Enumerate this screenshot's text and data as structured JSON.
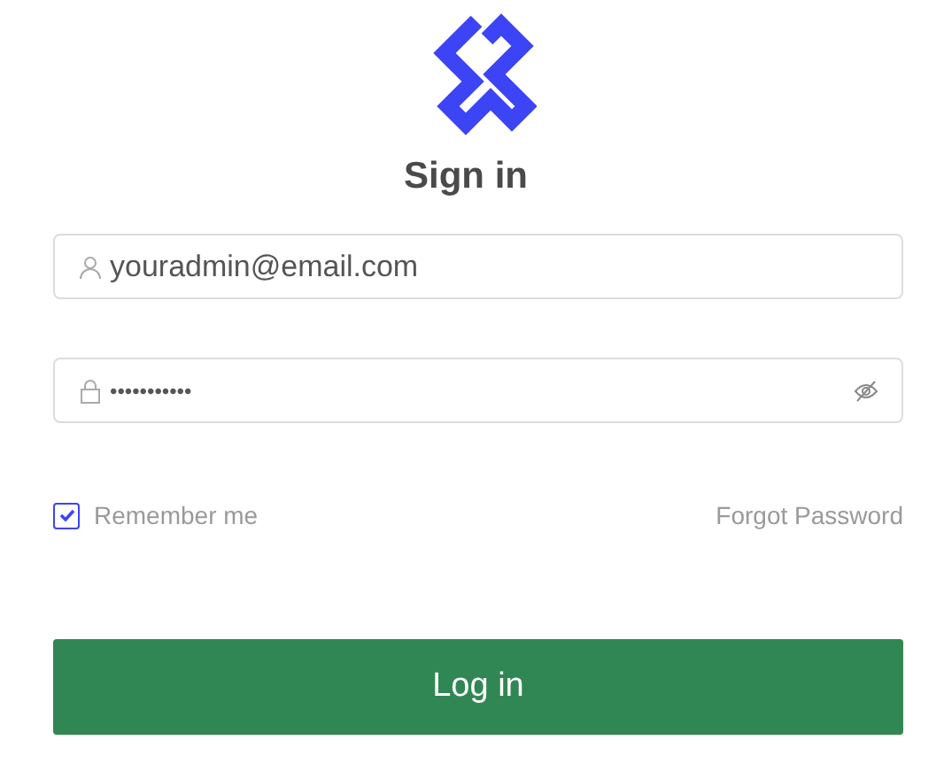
{
  "title": "Sign in",
  "email": {
    "value": "youradmin@email.com"
  },
  "password": {
    "value": "•••••••••••"
  },
  "remember": {
    "label": "Remember me",
    "checked": true
  },
  "forgot": "Forgot Password",
  "submit": "Log in"
}
